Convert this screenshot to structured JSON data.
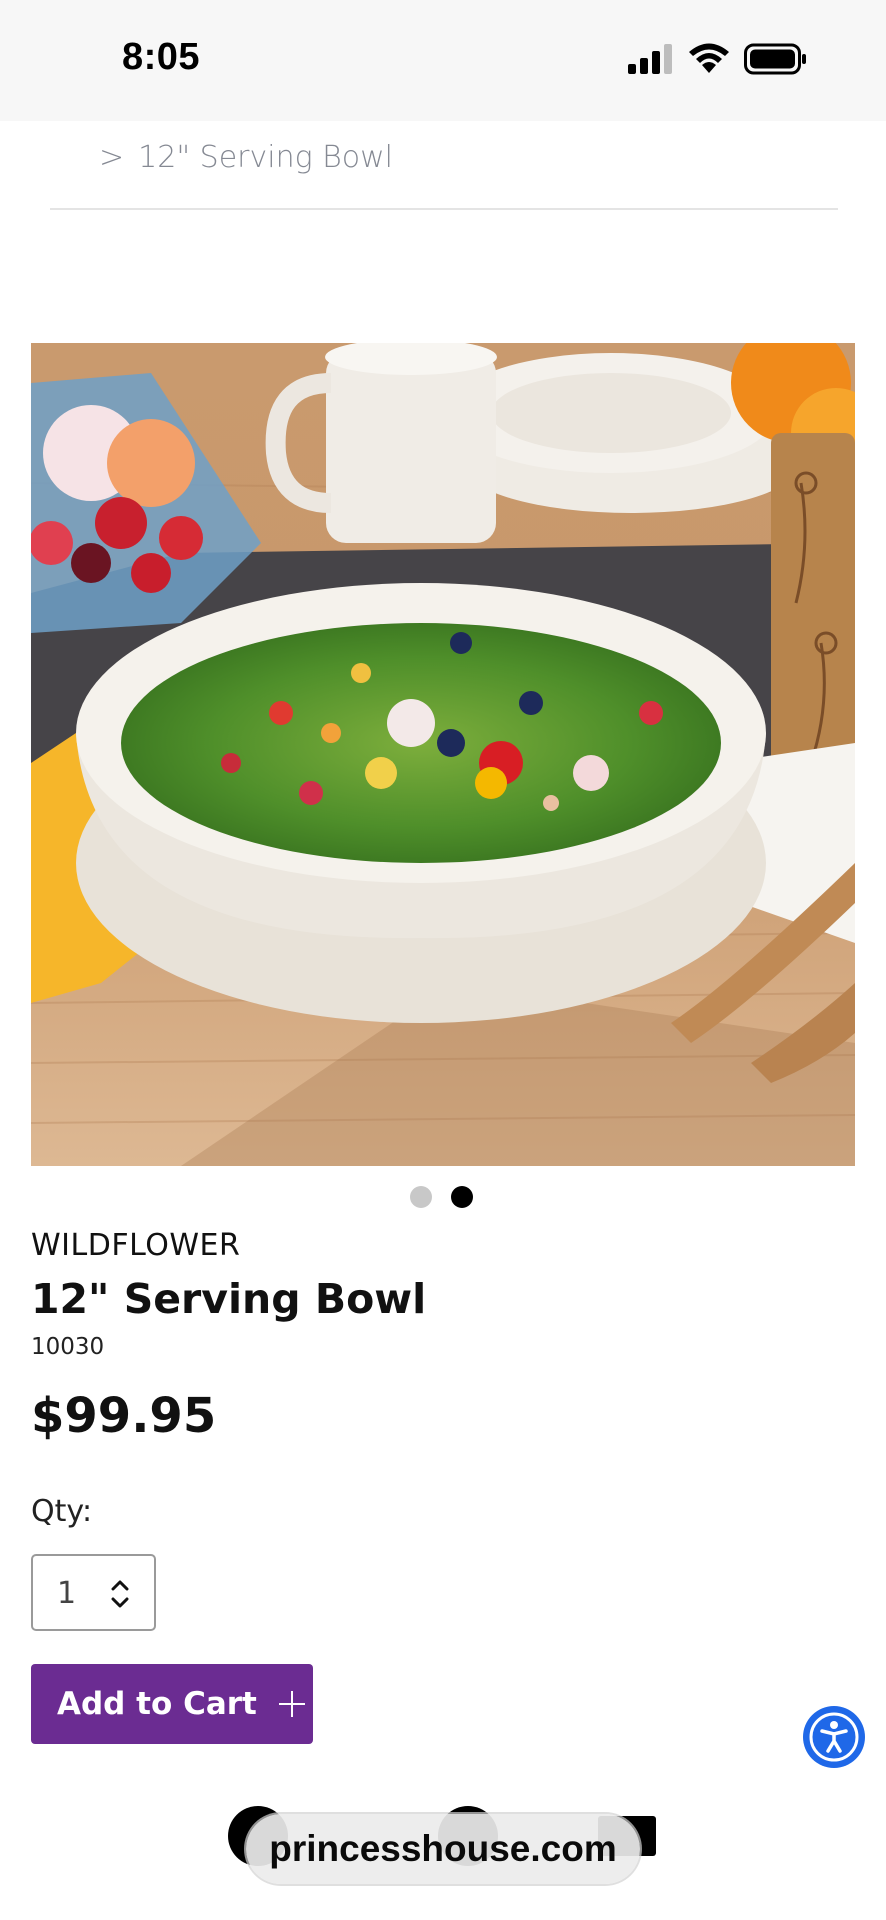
{
  "status_bar": {
    "time": "8:05"
  },
  "breadcrumb": {
    "separator": ">",
    "current": "12\" Serving Bowl"
  },
  "product": {
    "collection": "WILDFLOWER",
    "title": "12\" Serving Bowl",
    "sku": "10030",
    "price": "$99.95",
    "image_count": 2,
    "active_image": 2
  },
  "quantity": {
    "label": "Qty:",
    "value": "1"
  },
  "cart": {
    "add_label": "Add to Cart"
  },
  "browser": {
    "url": "princesshouse.com"
  },
  "colors": {
    "accent": "#6b2c92",
    "accessibility": "#1f68e8"
  },
  "icons": [
    "signal-icon",
    "wifi-icon",
    "battery-icon",
    "stepper-icon",
    "plus-icon",
    "accessibility-icon"
  ]
}
